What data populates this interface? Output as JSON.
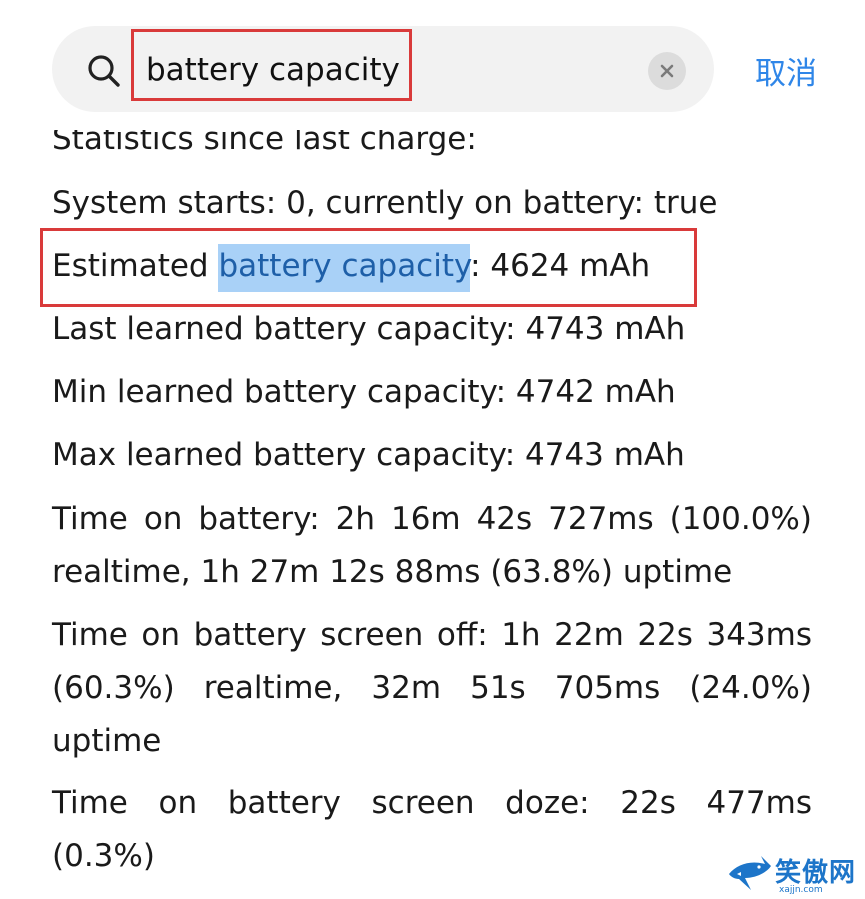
{
  "search": {
    "query": "battery capacity",
    "cancel_label": "取消"
  },
  "lines": {
    "statistics": "Statistics since last charge:",
    "system_starts": "System starts: 0, currently on battery: true",
    "estimated_prefix": "Estimated ",
    "estimated_match": "battery capacity",
    "estimated_suffix": ": 4624 mAh",
    "last_learned": "Last learned battery capacity: 4743 mAh",
    "min_learned": "Min learned battery capacity: 4742 mAh",
    "max_learned": "Max learned battery capacity: 4743 mAh",
    "time_on_battery_1": "Time on battery: 2h 16m 42s 727ms (100.0%)",
    "time_on_battery_2": "realtime, 1h 27m 12s 88ms (63.8%) uptime",
    "screen_off_1": "Time on battery screen off: 1h 22m 22s 343ms",
    "screen_off_2": "(60.3%) realtime, 32m 51s 705ms (24.0%)",
    "screen_off_3": "uptime",
    "screen_doze_1": "Time on battery screen doze: 22s 477ms",
    "screen_doze_2": "(0.3%)"
  },
  "watermark": {
    "brand": "笑傲网",
    "url": "xajjn.com"
  },
  "colors": {
    "accent": "#2f86e8",
    "highlight_bg": "#a9d1f7",
    "annotation_red": "#d93a3a"
  },
  "icons": {
    "search": "search-icon",
    "clear": "close-icon",
    "logo": "shark-logo-icon"
  }
}
